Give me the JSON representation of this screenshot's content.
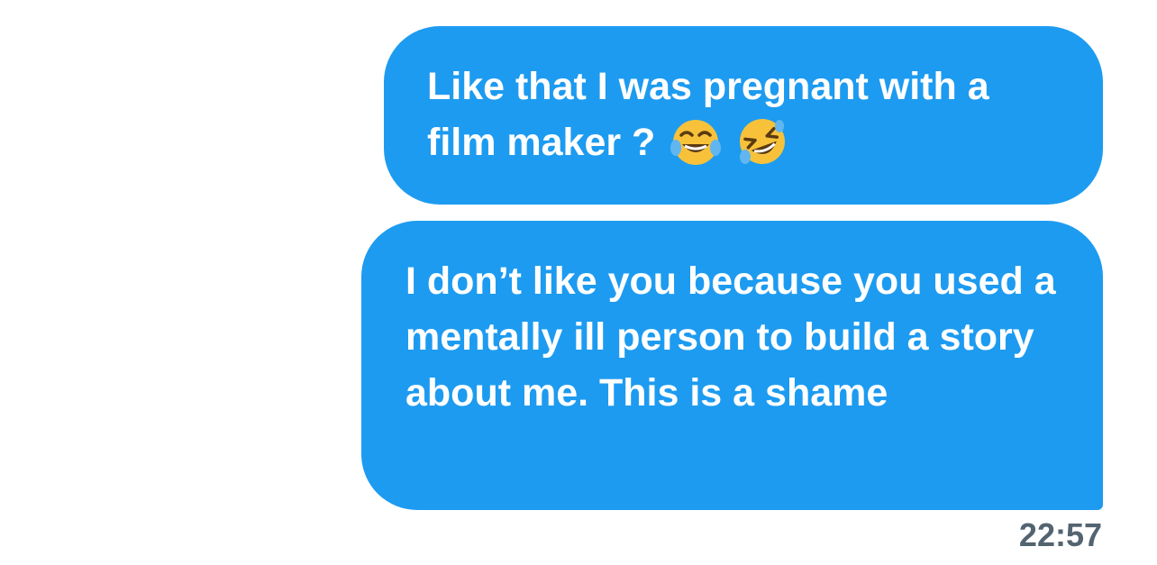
{
  "messages": [
    {
      "text": "Like that I was pregnant with a film maker ?",
      "emojis": [
        "face-with-tears-of-joy-icon",
        "rolling-on-the-floor-laughing-icon"
      ]
    },
    {
      "text": "I don’t like you because you used a mentally ill person to build a story about me. This is a shame"
    }
  ],
  "timestamp": "22:57",
  "colors": {
    "bubble": "#1d9bf0",
    "bubble_text": "#ffffff",
    "timestamp": "#536471",
    "background": "#ffffff"
  }
}
